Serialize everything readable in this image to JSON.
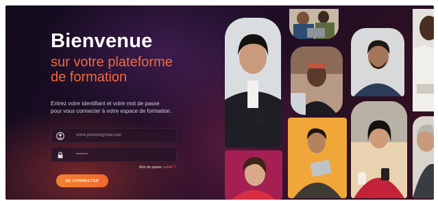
{
  "welcome": {
    "title": "Bienvenue",
    "subtitle_line1": "sur votre plateforme",
    "subtitle_line2": "de formation",
    "intro_line1": "Entrez votre identifiant et votre mot de passe",
    "intro_line2": "pour vous connecter à votre espace de formation."
  },
  "form": {
    "identifier_placeholder": "Votre.prenom@mail.com",
    "password_placeholder": "••••••••",
    "forgot_label": "Mot de passe",
    "forgot_link": "oublié ?",
    "submit_label": "SE CONNECTER"
  },
  "colors": {
    "accent": "#f26a3d",
    "button": "#f0782f",
    "background": "#1c0e26"
  },
  "icons": {
    "identifier": "user-icon",
    "password": "lock-icon"
  }
}
